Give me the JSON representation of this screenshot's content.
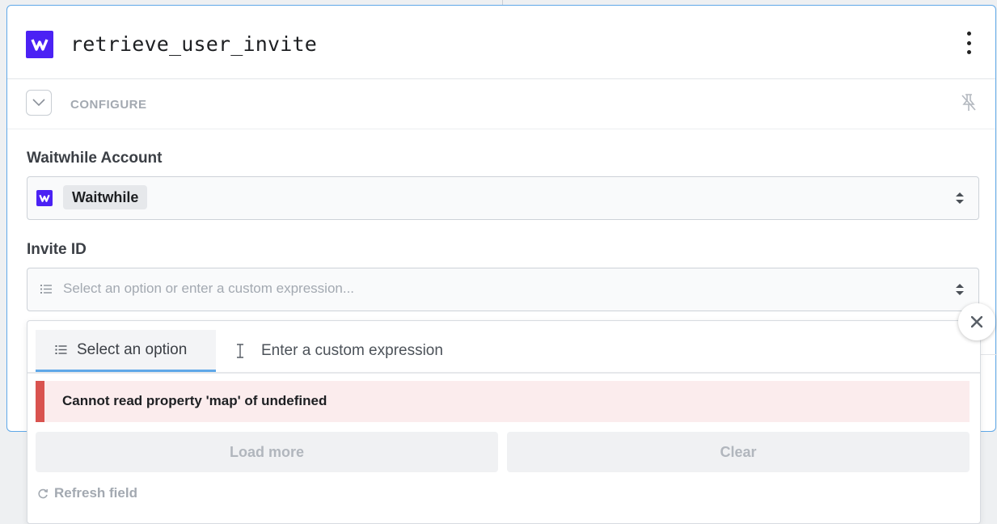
{
  "step": {
    "title": "retrieve_user_invite",
    "logo_icon": "waitwhile-logo-icon"
  },
  "configure": {
    "label": "CONFIGURE"
  },
  "fields": {
    "account": {
      "label": "Waitwhile Account",
      "value": "Waitwhile"
    },
    "invite_id": {
      "label": "Invite ID",
      "placeholder": "Select an option or enter a custom expression..."
    }
  },
  "dropdown": {
    "tabs": [
      {
        "label": "Select an option",
        "icon": "list-icon"
      },
      {
        "label": "Enter a custom expression",
        "icon": "text-cursor-icon"
      }
    ],
    "error_message": "Cannot read property 'map' of undefined",
    "load_more_label": "Load more",
    "clear_label": "Clear",
    "refresh_label": "Refresh field"
  },
  "colors": {
    "brand": "#4b22f4",
    "accent": "#5fa8e8",
    "error": "#d9534f",
    "error_bg": "#fbeced"
  }
}
